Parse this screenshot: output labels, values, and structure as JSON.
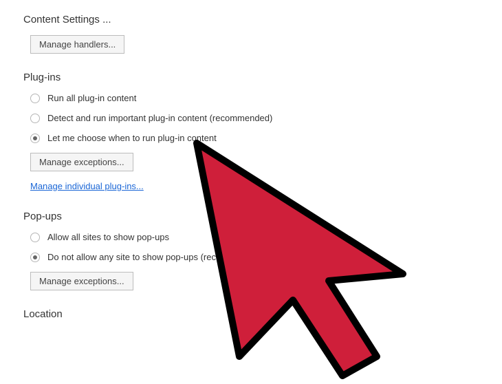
{
  "contentSettings": {
    "header": "Content Settings ...",
    "manageHandlers": "Manage handlers..."
  },
  "plugins": {
    "header": "Plug-ins",
    "options": [
      {
        "label": "Run all plug-in content",
        "selected": false
      },
      {
        "label": "Detect and run important plug-in content (recommended)",
        "selected": false
      },
      {
        "label": "Let me choose when to run plug-in content",
        "selected": true
      }
    ],
    "manageExceptions": "Manage exceptions...",
    "manageIndividual": "Manage individual plug-ins..."
  },
  "popups": {
    "header": "Pop-ups",
    "options": [
      {
        "label": "Allow all sites to show pop-ups",
        "selected": false
      },
      {
        "label": "Do not allow any site to show pop-ups (recommended)",
        "selected": true
      }
    ],
    "manageExceptions": "Manage exceptions..."
  },
  "location": {
    "header": "Location"
  }
}
